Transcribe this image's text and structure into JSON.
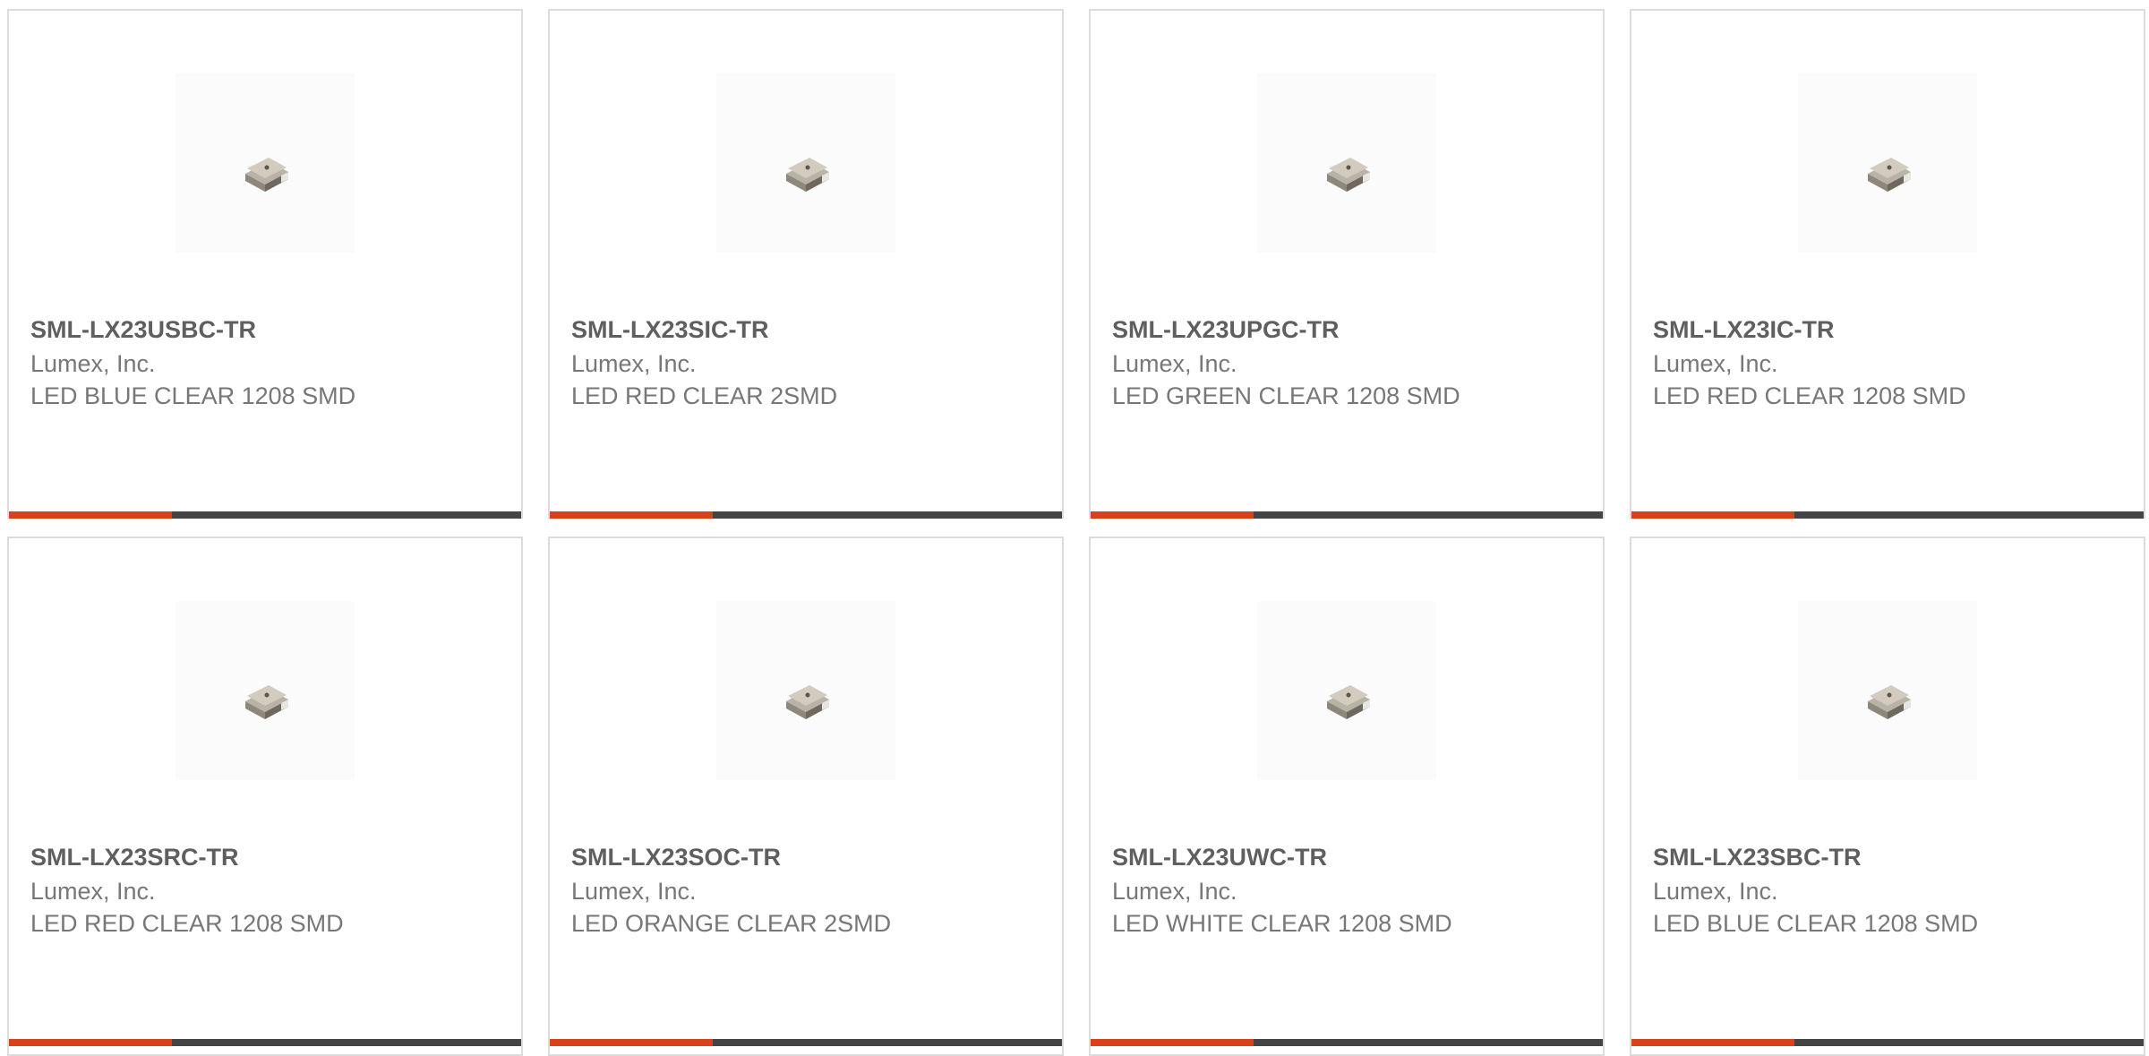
{
  "colors": {
    "accent": "#d7411b",
    "bar": "#444444",
    "border": "#dcdcdc",
    "title_text": "#5f5f5f",
    "body_text": "#777777"
  },
  "products": [
    {
      "part_number": "SML-LX23USBC-TR",
      "manufacturer": "Lumex, Inc.",
      "description": "LED BLUE CLEAR 1208 SMD",
      "image_icon": "smd-led-icon"
    },
    {
      "part_number": "SML-LX23SIC-TR",
      "manufacturer": "Lumex, Inc.",
      "description": "LED RED CLEAR 2SMD",
      "image_icon": "smd-led-icon"
    },
    {
      "part_number": "SML-LX23UPGC-TR",
      "manufacturer": "Lumex, Inc.",
      "description": "LED GREEN CLEAR 1208 SMD",
      "image_icon": "smd-led-icon"
    },
    {
      "part_number": "SML-LX23IC-TR",
      "manufacturer": "Lumex, Inc.",
      "description": "LED RED CLEAR 1208 SMD",
      "image_icon": "smd-led-icon"
    },
    {
      "part_number": "SML-LX23SRC-TR",
      "manufacturer": "Lumex, Inc.",
      "description": "LED RED CLEAR 1208 SMD",
      "image_icon": "smd-led-icon"
    },
    {
      "part_number": "SML-LX23SOC-TR",
      "manufacturer": "Lumex, Inc.",
      "description": "LED ORANGE CLEAR 2SMD",
      "image_icon": "smd-led-icon"
    },
    {
      "part_number": "SML-LX23UWC-TR",
      "manufacturer": "Lumex, Inc.",
      "description": "LED WHITE CLEAR 1208 SMD",
      "image_icon": "smd-led-icon"
    },
    {
      "part_number": "SML-LX23SBC-TR",
      "manufacturer": "Lumex, Inc.",
      "description": "LED BLUE CLEAR 1208 SMD",
      "image_icon": "smd-led-icon"
    }
  ]
}
